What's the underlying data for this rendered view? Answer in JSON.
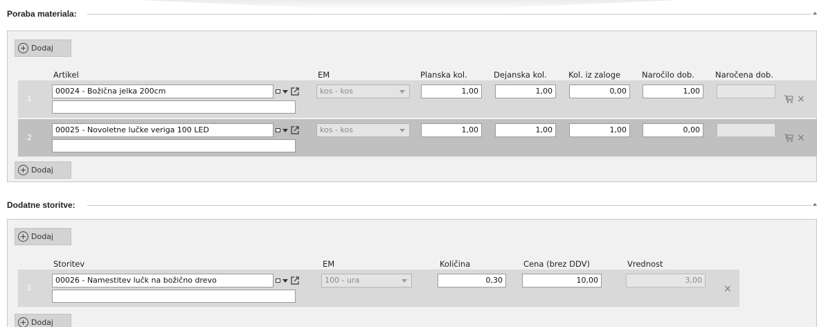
{
  "material": {
    "title": "Poraba materiala:",
    "add_label": "Dodaj",
    "headers": {
      "artikel": "Artikel",
      "em": "EM",
      "planska": "Planska kol.",
      "dejanska": "Dejanska kol.",
      "iz_zaloge": "Kol. iz zaloge",
      "narocilo": "Naročilo dob.",
      "narocena": "Naročena dob."
    },
    "rows": [
      {
        "num": "1",
        "artikel": "00024 - Božična jelka 200cm",
        "em": "kos - kos",
        "planska": "1,00",
        "dejanska": "1,00",
        "iz_zaloge": "0,00",
        "narocilo": "1,00",
        "narocena": ""
      },
      {
        "num": "2",
        "artikel": "00025 - Novoletne lučke veriga 100 LED",
        "em": "kos - kos",
        "planska": "1,00",
        "dejanska": "1,00",
        "iz_zaloge": "1,00",
        "narocilo": "0,00",
        "narocena": ""
      }
    ]
  },
  "services": {
    "title": "Dodatne storitve:",
    "add_label": "Dodaj",
    "headers": {
      "storitev": "Storitev",
      "em": "EM",
      "kolicina": "Količina",
      "cena": "Cena (brez DDV)",
      "vrednost": "Vrednost"
    },
    "rows": [
      {
        "num": "1",
        "storitev": "00026 - Namestitev lučk na božično drevo",
        "em": "100 - ura",
        "kolicina": "0,30",
        "cena": "10,00",
        "vrednost": "3,00"
      }
    ]
  },
  "icons": {
    "close": "×"
  }
}
